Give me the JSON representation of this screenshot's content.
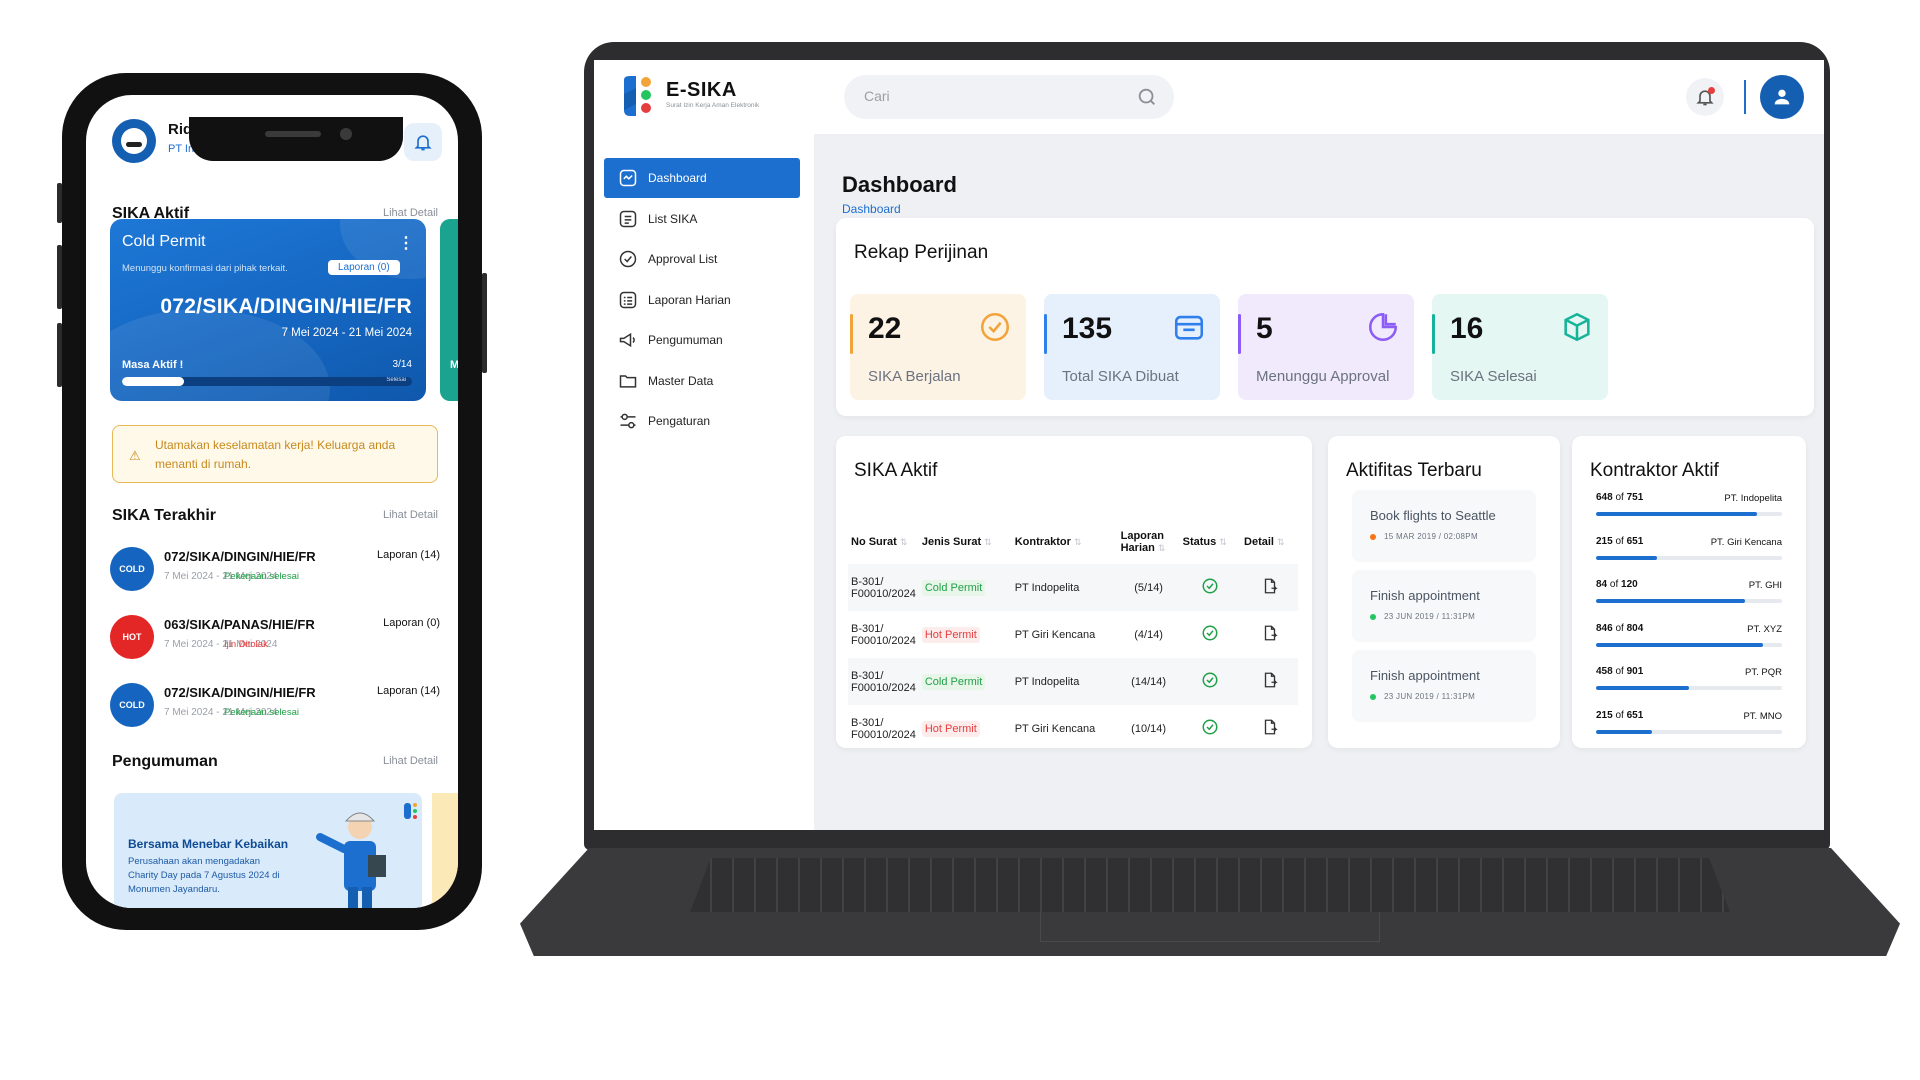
{
  "phone": {
    "user_name": "Ridwan Maulana",
    "company": "PT Indopelita",
    "sika_aktif_title": "SIKA Aktif",
    "sika_aktif_link": "Lihat Detail",
    "card": {
      "title": "Cold Permit",
      "subtitle": "Menunggu konfirmasi dari pihak terkait.",
      "badge": "Laporan (0)",
      "number": "072/SIKA/DINGIN/HIE/FR",
      "date_range": "7 Mei 2024 - 21 Mei 2024",
      "masa_label": "Masa Aktif !",
      "count": "3/14",
      "progress": 0.214,
      "bar_label": "Selesai"
    },
    "peek_label": "M",
    "warning": "Utamakan keselamatan kerja! Keluarga anda menanti di rumah.",
    "sika_terakhir_title": "SIKA Terakhir",
    "sika_terakhir_link": "Lihat Detail",
    "recent": [
      {
        "badge": "COLD",
        "badge_color": "#1565c0",
        "number": "072/SIKA/DINGIN/HIE/FR",
        "date": "7 Mei 2024 - 21 Mei 2024",
        "laporan": "Laporan (14)",
        "status": "Pekerjaan selesai",
        "status_color": "#21a049"
      },
      {
        "badge": "HOT",
        "badge_color": "#e32626",
        "number": "063/SIKA/PANAS/HIE/FR",
        "date": "7 Mei 2024 - 21 Mei 2024",
        "laporan": "Laporan (0)",
        "status": "Ijin Ditolak",
        "status_color": "#e53e3e"
      },
      {
        "badge": "COLD",
        "badge_color": "#1565c0",
        "number": "072/SIKA/DINGIN/HIE/FR",
        "date": "7 Mei 2024 - 21 Mei 2024",
        "laporan": "Laporan (14)",
        "status": "Pekerjaan selesai",
        "status_color": "#21a049"
      }
    ],
    "pengumuman_title": "Pengumuman",
    "pengumuman_link": "Lihat Detail",
    "banner_title": "Bersama Menebar Kebaikan",
    "banner_body": "Perusahaan akan mengadakan Charity Day pada 7 Agustus 2024 di Monumen Jayandaru."
  },
  "desktop": {
    "brand": "E-SIKA",
    "brand_sub": "Surat Izin Kerja Aman Elektronik",
    "search_placeholder": "Cari",
    "nav": [
      {
        "label": "Dashboard",
        "icon": "dashboard-icon",
        "active": true
      },
      {
        "label": "List SIKA",
        "icon": "list-icon",
        "active": false
      },
      {
        "label": "Approval List",
        "icon": "check-circle-icon",
        "active": false
      },
      {
        "label": "Laporan Harian",
        "icon": "report-icon",
        "active": false
      },
      {
        "label": "Pengumuman",
        "icon": "megaphone-icon",
        "active": false
      },
      {
        "label": "Master Data",
        "icon": "folder-icon",
        "active": false
      },
      {
        "label": "Pengaturan",
        "icon": "settings-icon",
        "active": false
      }
    ],
    "page_title": "Dashboard",
    "breadcrumb": "Dashboard",
    "rekap": {
      "title": "Rekap Perijinan",
      "stats": [
        {
          "value": "22",
          "label": "SIKA Berjalan",
          "color": "#f2a43a",
          "bg": "#fdf3e4",
          "icon": "check-badge-icon"
        },
        {
          "value": "135",
          "label": "Total SIKA Dibuat",
          "color": "#2f80ed",
          "bg": "#e6f0fc",
          "icon": "calendar-icon"
        },
        {
          "value": "5",
          "label": "Menunggu Approval",
          "color": "#8b5cf6",
          "bg": "#f1eafd",
          "icon": "pie-icon"
        },
        {
          "value": "16",
          "label": "SIKA Selesai",
          "color": "#16b39a",
          "bg": "#e4f7f2",
          "icon": "box-icon"
        }
      ]
    },
    "sika_aktif": {
      "title": "SIKA Aktif",
      "columns": [
        "No Surat",
        "Jenis Surat",
        "Kontraktor",
        "Laporan Harian",
        "Status",
        "Detail"
      ],
      "rows": [
        {
          "no": "B-301/ F00010/2024",
          "jenis": "Cold Permit",
          "type": "cold",
          "kontraktor": "PT Indopelita",
          "laporan": "(5/14)"
        },
        {
          "no": "B-301/ F00010/2024",
          "jenis": "Hot Permit",
          "type": "hot",
          "kontraktor": "PT Giri Kencana",
          "laporan": "(4/14)"
        },
        {
          "no": "B-301/ F00010/2024",
          "jenis": "Cold Permit",
          "type": "cold",
          "kontraktor": "PT Indopelita",
          "laporan": "(14/14)"
        },
        {
          "no": "B-301/ F00010/2024",
          "jenis": "Hot Permit",
          "type": "hot",
          "kontraktor": "PT Giri Kencana",
          "laporan": "(10/14)"
        }
      ]
    },
    "aktifitas": {
      "title": "Aktifitas Terbaru",
      "items": [
        {
          "title": "Book flights to Seattle",
          "meta": "15 MAR 2019  /  02:08PM",
          "dot": "#f97316"
        },
        {
          "title": "Finish appointment",
          "meta": "23 JUN 2019  /  11:31PM",
          "dot": "#22c55e"
        },
        {
          "title": "Finish appointment",
          "meta": "23 JUN 2019  /  11:31PM",
          "dot": "#22c55e"
        }
      ]
    },
    "kontraktor": {
      "title": "Kontraktor Aktif",
      "items": [
        {
          "count": "648",
          "total": "751",
          "name": "PT. Indopelita",
          "ratio": 0.863
        },
        {
          "count": "215",
          "total": "651",
          "name": "PT. Giri Kencana",
          "ratio": 0.33
        },
        {
          "count": "84",
          "total": "120",
          "name": "PT. GHI",
          "ratio": 0.8
        },
        {
          "count": "846",
          "total": "804",
          "name": "PT. XYZ",
          "ratio": 0.9
        },
        {
          "count": "458",
          "total": "901",
          "name": "PT. PQR",
          "ratio": 0.5
        },
        {
          "count": "215",
          "total": "651",
          "name": "PT. MNO",
          "ratio": 0.3
        }
      ]
    }
  }
}
